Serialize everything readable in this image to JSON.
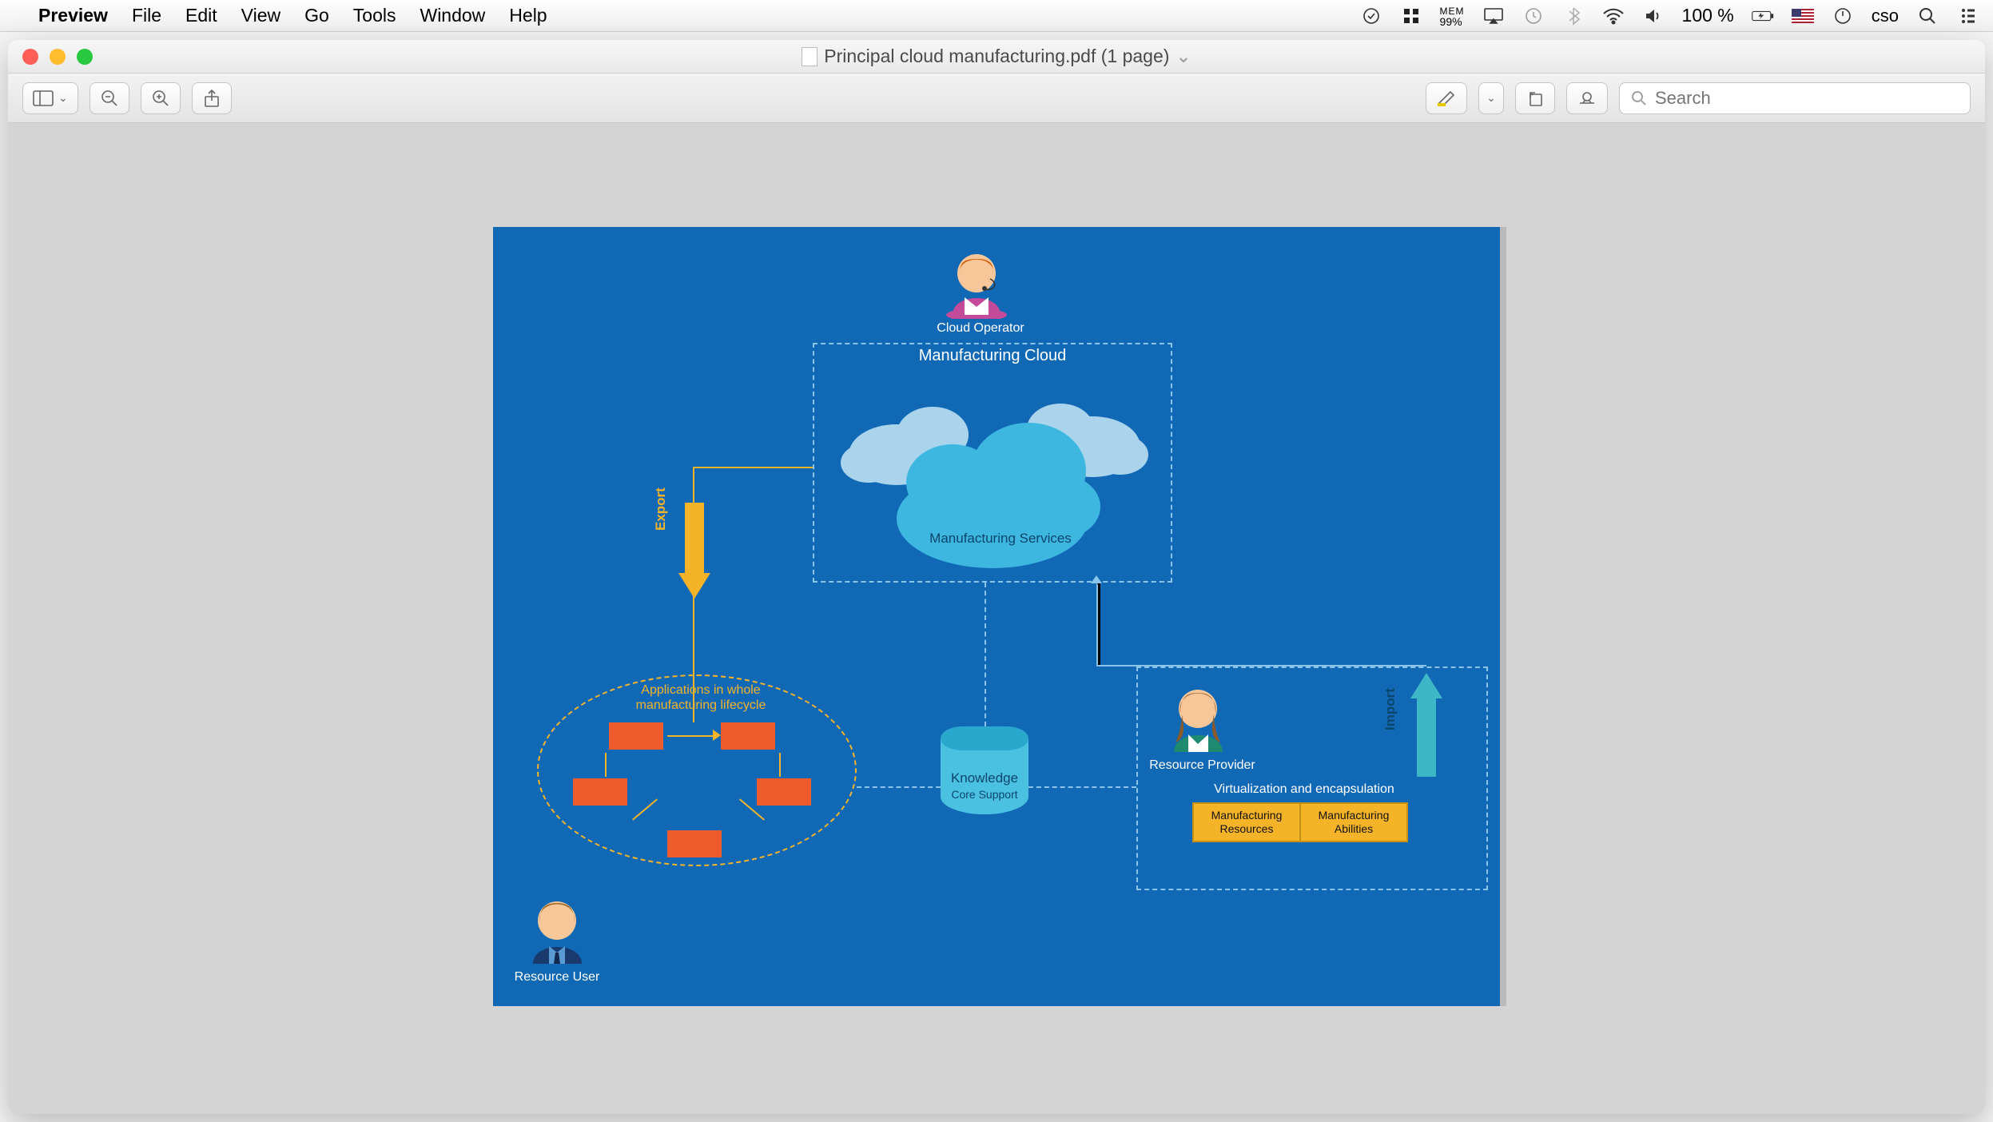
{
  "menubar": {
    "app_name": "Preview",
    "items": [
      "File",
      "Edit",
      "View",
      "Go",
      "Tools",
      "Window",
      "Help"
    ],
    "mem_label": "MEM",
    "mem_value": "99%",
    "battery": "100 %",
    "username": "cso"
  },
  "window": {
    "title": "Principal cloud manufacturing.pdf (1 page)"
  },
  "toolbar": {
    "search_placeholder": "Search"
  },
  "diagram": {
    "cloud_operator": "Cloud Operator",
    "manufacturing_cloud": "Manufacturing Cloud",
    "manufacturing_services": "Manufacturing Services",
    "export_label": "Export",
    "import_label": "Import",
    "applications_label_l1": "Applications in whole",
    "applications_label_l2": "manufacturing lifecycle",
    "knowledge_label": "Knowledge",
    "core_support_label": "Core Support",
    "resource_provider": "Resource Provider",
    "virtualization_label": "Virtualization and encapsulation",
    "mfg_resources_l1": "Manufacturing",
    "mfg_resources_l2": "Resources",
    "mfg_abilities_l1": "Manufacturing",
    "mfg_abilities_l2": "Abilities",
    "resource_user": "Resource User"
  }
}
